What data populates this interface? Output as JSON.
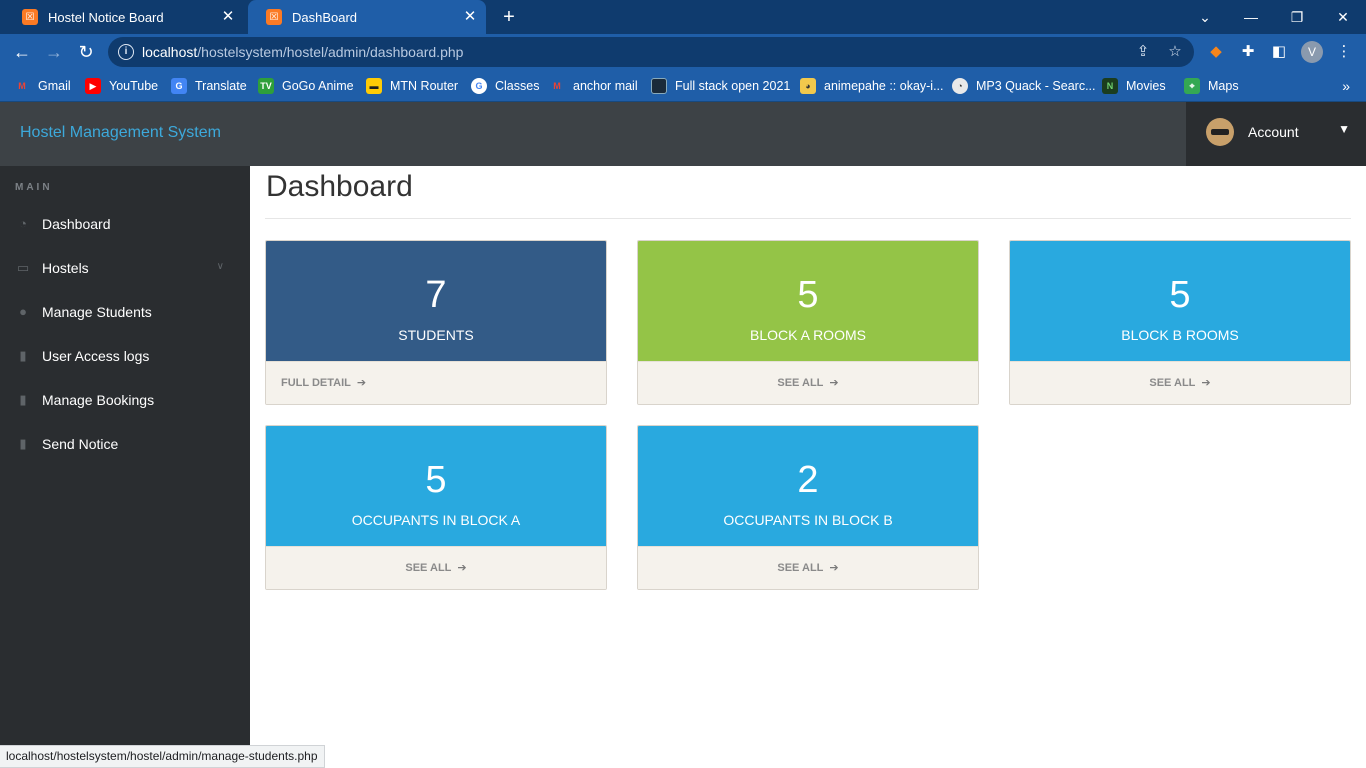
{
  "browser": {
    "tabs": [
      {
        "title": "Hostel Notice Board",
        "active": false
      },
      {
        "title": "DashBoard",
        "active": true
      }
    ],
    "url_host": "localhost",
    "url_path": "/hostelsystem/hostel/admin/dashboard.php",
    "profile_initial": "V",
    "bookmarks": [
      {
        "label": "Gmail",
        "icon": "gmail-icon",
        "color": "#ea4335"
      },
      {
        "label": "YouTube",
        "icon": "youtube-icon",
        "color": "#ff0000"
      },
      {
        "label": "Translate",
        "icon": "translate-icon",
        "color": "#4285f4"
      },
      {
        "label": "GoGo Anime",
        "icon": "gogoanime-icon",
        "color": "#2e9f3b"
      },
      {
        "label": "MTN Router",
        "icon": "router-icon",
        "color": "#ffcb05"
      },
      {
        "label": "Classes",
        "icon": "google-icon",
        "color": "#ffffff"
      },
      {
        "label": "anchor mail",
        "icon": "gmail-icon",
        "color": "#ea4335"
      },
      {
        "label": "Full stack open 2021",
        "icon": "fullstack-icon",
        "color": "#1a2a3a"
      },
      {
        "label": "animepahe :: okay-i...",
        "icon": "animepahe-icon",
        "color": "#f2c94c"
      },
      {
        "label": "MP3 Quack - Searc...",
        "icon": "duck-icon",
        "color": "#e9e9e9"
      },
      {
        "label": "Movies",
        "icon": "movies-icon",
        "color": "#2e7d32"
      },
      {
        "label": "Maps",
        "icon": "maps-icon",
        "color": "#34a853"
      }
    ],
    "status_url": "localhost/hostelsystem/hostel/admin/manage-students.php"
  },
  "header": {
    "brand": "Hostel Management System",
    "account_label": "Account"
  },
  "sidebar": {
    "section": "MAIN",
    "items": [
      {
        "label": "Dashboard",
        "icon": "dashboard-icon"
      },
      {
        "label": "Hostels",
        "icon": "desktop-icon",
        "has_caret": true
      },
      {
        "label": "Manage Students",
        "icon": "users-icon"
      },
      {
        "label": "User Access logs",
        "icon": "file-icon"
      },
      {
        "label": "Manage Bookings",
        "icon": "file-icon"
      },
      {
        "label": "Send Notice",
        "icon": "file-icon"
      }
    ]
  },
  "main": {
    "title": "Dashboard",
    "cards": [
      {
        "value": "7",
        "label": "STUDENTS",
        "link": "FULL DETAIL",
        "color": "#335b87"
      },
      {
        "value": "5",
        "label": "BLOCK A ROOMS",
        "link": "SEE ALL",
        "color": "#94c447"
      },
      {
        "value": "5",
        "label": "BLOCK B ROOMS",
        "link": "SEE ALL",
        "color": "#29a9df"
      },
      {
        "value": "5",
        "label": "OCCUPANTS IN BLOCK A",
        "link": "SEE ALL",
        "color": "#29a9df"
      },
      {
        "value": "2",
        "label": "OCCUPANTS IN BLOCK B",
        "link": "SEE ALL",
        "color": "#29a9df"
      }
    ]
  }
}
